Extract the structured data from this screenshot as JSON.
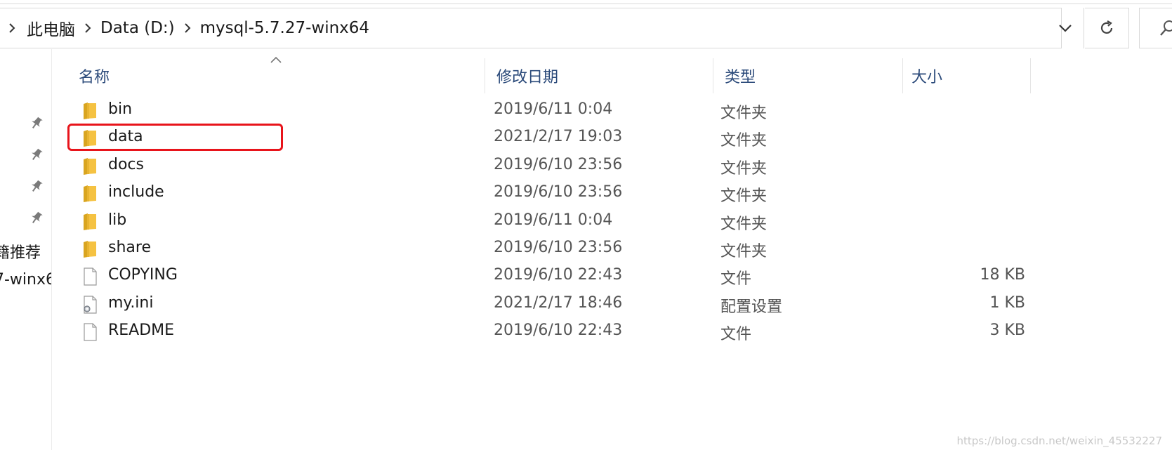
{
  "breadcrumb": {
    "items": [
      "此电脑",
      "Data (D:)",
      "mysql-5.7.27-winx64"
    ]
  },
  "navpane": {
    "partial_items": [
      "籍推荐",
      "7-winx6"
    ]
  },
  "columns": {
    "name": "名称",
    "date": "修改日期",
    "type": "类型",
    "size": "大小"
  },
  "files": [
    {
      "name": "bin",
      "date": "2019/6/11 0:04",
      "type": "文件夹",
      "size": "",
      "icon": "folder-icon"
    },
    {
      "name": "data",
      "date": "2021/2/17 19:03",
      "type": "文件夹",
      "size": "",
      "icon": "folder-icon"
    },
    {
      "name": "docs",
      "date": "2019/6/10 23:56",
      "type": "文件夹",
      "size": "",
      "icon": "folder-icon"
    },
    {
      "name": "include",
      "date": "2019/6/10 23:56",
      "type": "文件夹",
      "size": "",
      "icon": "folder-icon"
    },
    {
      "name": "lib",
      "date": "2019/6/11 0:04",
      "type": "文件夹",
      "size": "",
      "icon": "folder-icon"
    },
    {
      "name": "share",
      "date": "2019/6/10 23:56",
      "type": "文件夹",
      "size": "",
      "icon": "folder-icon"
    },
    {
      "name": "COPYING",
      "date": "2019/6/10 22:43",
      "type": "文件",
      "size": "18 KB",
      "icon": "file-icon"
    },
    {
      "name": "my.ini",
      "date": "2021/2/17 18:46",
      "type": "配置设置",
      "size": "1 KB",
      "icon": "config-file-icon"
    },
    {
      "name": "README",
      "date": "2019/6/10 22:43",
      "type": "文件",
      "size": "3 KB",
      "icon": "file-icon"
    }
  ],
  "watermark": "https://blog.csdn.net/weixin_45532227",
  "colors": {
    "highlight": "#e8141b",
    "header_text": "#2b4a7a",
    "folder": "#f5c242"
  }
}
